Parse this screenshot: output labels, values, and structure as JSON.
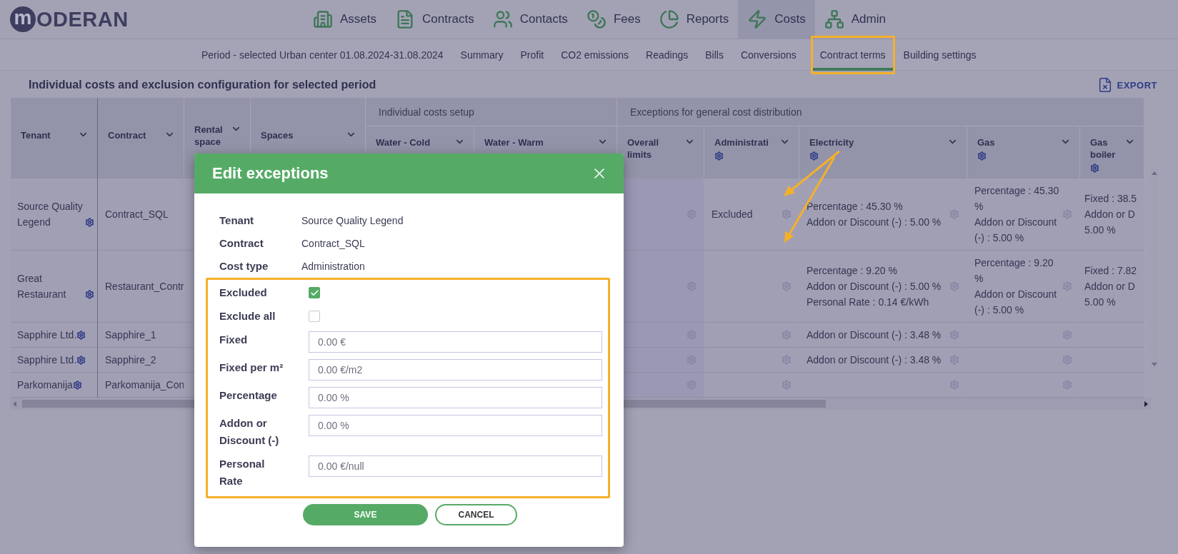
{
  "logo": {
    "mark": "m",
    "text": "ODERAN"
  },
  "nav": [
    {
      "label": "Assets",
      "selected": false
    },
    {
      "label": "Contracts",
      "selected": false
    },
    {
      "label": "Contacts",
      "selected": false
    },
    {
      "label": "Fees",
      "selected": false
    },
    {
      "label": "Reports",
      "selected": false
    },
    {
      "label": "Costs",
      "selected": true
    },
    {
      "label": "Admin",
      "selected": false
    }
  ],
  "subnav": {
    "period": "Period - selected Urban center 01.08.2024-31.08.2024",
    "tabs": [
      {
        "label": "Summary",
        "selected": false,
        "highlighted": false
      },
      {
        "label": "Profit",
        "selected": false,
        "highlighted": false
      },
      {
        "label": "CO2 emissions",
        "selected": false,
        "highlighted": false
      },
      {
        "label": "Readings",
        "selected": false,
        "highlighted": false
      },
      {
        "label": "Bills",
        "selected": false,
        "highlighted": false
      },
      {
        "label": "Conversions",
        "selected": false,
        "highlighted": false
      },
      {
        "label": "Contract terms",
        "selected": true,
        "highlighted": true
      },
      {
        "label": "Building settings",
        "selected": false,
        "highlighted": false
      }
    ]
  },
  "page_title": "Individual costs and exclusion configuration for selected period",
  "export_label": "EXPORT",
  "table": {
    "columns": [
      {
        "kind": "column",
        "label": "Tenant"
      },
      {
        "kind": "column",
        "label": "Contract"
      },
      {
        "kind": "column",
        "label": "Rental space"
      },
      {
        "kind": "column",
        "label": "Spaces"
      },
      {
        "kind": "group",
        "label": "Individual costs setup",
        "columns": [
          {
            "label": "Water - Cold"
          },
          {
            "label": "Water - Warm"
          }
        ]
      },
      {
        "kind": "group",
        "label": "Exceptions for general cost distribution",
        "columns": [
          {
            "label": "Overall limits",
            "cell_gear": true,
            "shaded": true
          },
          {
            "label": "Administrati",
            "gear": true,
            "cell_gear": true
          },
          {
            "label": "Electricity",
            "gear": true,
            "cell_gear": true
          },
          {
            "label": "Gas",
            "gear": true,
            "cell_gear": true
          },
          {
            "label": "Gas boiler",
            "gear": true
          }
        ]
      }
    ],
    "rows": [
      {
        "tenant": "Source Quality Legend",
        "contract": "Contract_SQL",
        "administration": [
          "Excluded"
        ],
        "electricity": [
          "Percentage : 45.30 %",
          "Addon or Discount (-) : 5.00 %"
        ],
        "gas": [
          "Percentage : 45.30 %",
          "Addon or Discount (-) : 5.00 %"
        ],
        "gas_boiler": [
          "Fixed : 38.5",
          "Addon or D",
          "5.00 %"
        ]
      },
      {
        "tenant": "Great Restaurant",
        "contract": "Restaurant_Contr",
        "electricity": [
          "Percentage : 9.20 %",
          "Addon or Discount (-) : 5.00 %",
          "Personal Rate : 0.14 €/kWh"
        ],
        "gas": [
          "Percentage : 9.20 %",
          "Addon or Discount (-) : 5.00 %"
        ],
        "gas_boiler": [
          "Fixed : 7.82",
          "Addon or D",
          "5.00 %"
        ]
      },
      {
        "tenant": "Sapphire Ltd.",
        "contract": "Sapphire_1",
        "electricity": [
          "Addon or Discount (-) : 3.48 %"
        ]
      },
      {
        "tenant": "Sapphire Ltd.",
        "contract": "Sapphire_2",
        "electricity": [
          "Addon or Discount (-) : 3.48 %"
        ]
      },
      {
        "tenant": "Parkomanija",
        "contract": "Parkomanija_Con"
      }
    ]
  },
  "modal": {
    "title": "Edit exceptions",
    "info": [
      {
        "label": "Tenant",
        "value": "Source Quality Legend"
      },
      {
        "label": "Contract",
        "value": "Contract_SQL"
      },
      {
        "label": "Cost type",
        "value": "Administration"
      }
    ],
    "fields": [
      {
        "kind": "checkbox",
        "label": "Excluded",
        "checked": true
      },
      {
        "kind": "checkbox",
        "label": "Exclude all",
        "checked": false
      },
      {
        "kind": "input",
        "label": "Fixed",
        "value": "0.00 €"
      },
      {
        "kind": "input",
        "label": "Fixed per m²",
        "value": "0.00 €/m2"
      },
      {
        "kind": "input",
        "label": "Percentage",
        "value": "0.00 %"
      },
      {
        "kind": "input",
        "label": "Addon or Discount (-)",
        "value": "0.00 %"
      },
      {
        "kind": "input",
        "label": "Personal Rate",
        "value": "0.00 €/null"
      }
    ],
    "buttons": [
      {
        "kind": "primary",
        "label": "SAVE"
      },
      {
        "kind": "secondary",
        "label": "CANCEL"
      }
    ]
  }
}
